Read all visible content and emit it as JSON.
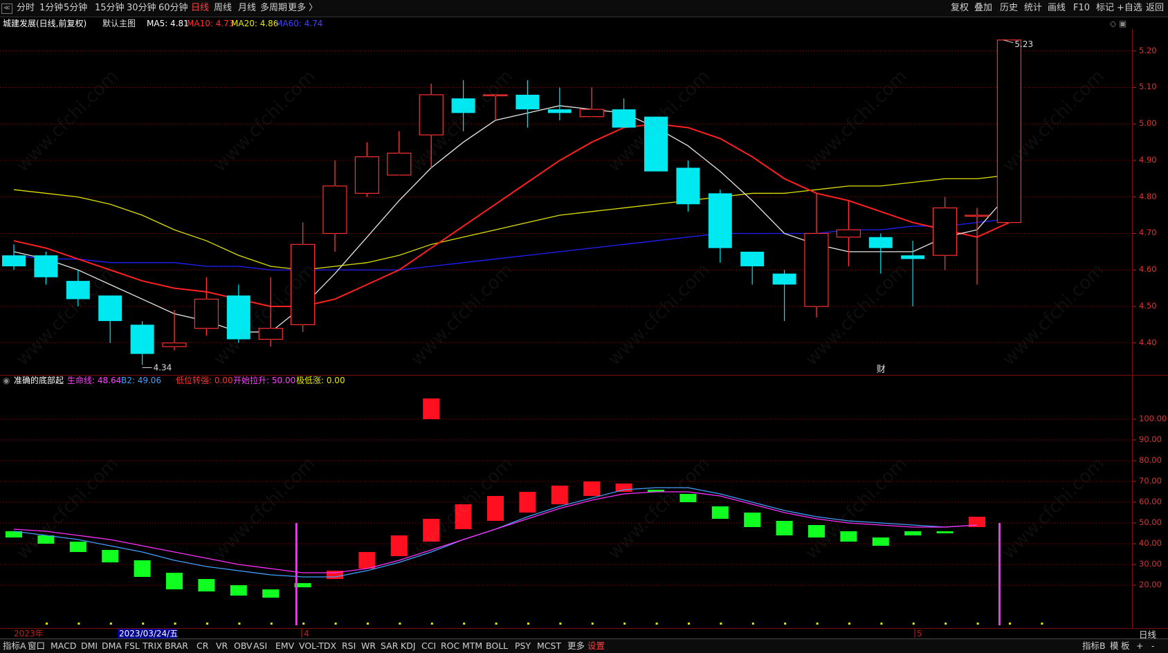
{
  "toolbar": {
    "periods": [
      "分时",
      "1分钟",
      "5分钟",
      "15分钟",
      "30分钟",
      "60分钟",
      "日线",
      "周线",
      "月线",
      "多周期",
      "更多 〉"
    ],
    "active_period": "日线",
    "right_buttons": [
      "复权",
      "叠加",
      "历史",
      "统计",
      "画线",
      "F10",
      "标记",
      "+自选",
      "返回"
    ],
    "back_glyph": "≪"
  },
  "main_info": {
    "title": "城建发展(日线,前复权)",
    "chart_name": "默认主图",
    "ma5": "MA5: 4.81",
    "ma10": "MA10: 4.73",
    "ma20": "MA20: 4.86",
    "ma60": "MA60: 4.74"
  },
  "indicator_info": {
    "name": "准确的底部起",
    "line1": "生命线: 48.64",
    "line2": "B2: 49.06",
    "v1": "低位转强: 0.00",
    "v2": "开始拉升: 50.00",
    "v3": "极低涨: 0.00"
  },
  "colors": {
    "up": "#ff3030",
    "down": "#00e8f0",
    "ma5": "#e8e8e8",
    "ma10": "#ff2020",
    "ma20": "#e0e000",
    "ma60": "#2020ff",
    "ind_up": "#ff1020",
    "ind_down": "#10ff20",
    "life_line": "#ff30ff",
    "b2_line": "#40a0ff",
    "grid": "#7a1010"
  },
  "chart_data": [
    {
      "type": "candlestick",
      "title": "城建发展(日线,前复权)",
      "y_ticks": [
        "5.20",
        "5.10",
        "5.00",
        "4.90",
        "4.80",
        "4.70",
        "4.60",
        "4.50",
        "4.40"
      ],
      "ylim": [
        4.32,
        5.26
      ],
      "candles": [
        {
          "o": 4.64,
          "h": 4.67,
          "l": 4.6,
          "c": 4.61
        },
        {
          "o": 4.64,
          "h": 4.65,
          "l": 4.56,
          "c": 4.58
        },
        {
          "o": 4.57,
          "h": 4.6,
          "l": 4.5,
          "c": 4.52
        },
        {
          "o": 4.53,
          "h": 4.53,
          "l": 4.4,
          "c": 4.46
        },
        {
          "o": 4.45,
          "h": 4.46,
          "l": 4.34,
          "c": 4.37
        },
        {
          "o": 4.39,
          "h": 4.49,
          "l": 4.38,
          "c": 4.4
        },
        {
          "o": 4.44,
          "h": 4.58,
          "l": 4.42,
          "c": 4.52
        },
        {
          "o": 4.53,
          "h": 4.56,
          "l": 4.4,
          "c": 4.41
        },
        {
          "o": 4.41,
          "h": 4.58,
          "l": 4.39,
          "c": 4.44
        },
        {
          "o": 4.45,
          "h": 4.73,
          "l": 4.43,
          "c": 4.67
        },
        {
          "o": 4.7,
          "h": 4.9,
          "l": 4.65,
          "c": 4.83
        },
        {
          "o": 4.81,
          "h": 4.95,
          "l": 4.8,
          "c": 4.91
        },
        {
          "o": 4.86,
          "h": 4.98,
          "l": 4.86,
          "c": 4.92
        },
        {
          "o": 4.97,
          "h": 5.11,
          "l": 4.88,
          "c": 5.08
        },
        {
          "o": 5.07,
          "h": 5.12,
          "l": 4.98,
          "c": 5.03
        },
        {
          "o": 5.08,
          "h": 5.08,
          "l": 5.01,
          "c": 5.08
        },
        {
          "o": 5.08,
          "h": 5.12,
          "l": 4.99,
          "c": 5.04
        },
        {
          "o": 5.04,
          "h": 5.1,
          "l": 5.01,
          "c": 5.03
        },
        {
          "o": 5.02,
          "h": 5.1,
          "l": 5.02,
          "c": 5.04
        },
        {
          "o": 5.04,
          "h": 5.07,
          "l": 4.99,
          "c": 4.99
        },
        {
          "o": 5.02,
          "h": 5.02,
          "l": 4.87,
          "c": 4.87
        },
        {
          "o": 4.88,
          "h": 4.9,
          "l": 4.76,
          "c": 4.78
        },
        {
          "o": 4.81,
          "h": 4.82,
          "l": 4.62,
          "c": 4.66
        },
        {
          "o": 4.65,
          "h": 4.65,
          "l": 4.56,
          "c": 4.61
        },
        {
          "o": 4.59,
          "h": 4.6,
          "l": 4.46,
          "c": 4.56
        },
        {
          "o": 4.5,
          "h": 4.81,
          "l": 4.47,
          "c": 4.7
        },
        {
          "o": 4.69,
          "h": 4.79,
          "l": 4.61,
          "c": 4.71
        },
        {
          "o": 4.69,
          "h": 4.7,
          "l": 4.59,
          "c": 4.66
        },
        {
          "o": 4.64,
          "h": 4.68,
          "l": 4.5,
          "c": 4.63
        },
        {
          "o": 4.64,
          "h": 4.8,
          "l": 4.6,
          "c": 4.77
        },
        {
          "o": 4.75,
          "h": 4.77,
          "l": 4.56,
          "c": 4.75
        },
        {
          "o": 4.73,
          "h": 5.23,
          "l": 4.73,
          "c": 5.23
        }
      ],
      "ma5": [
        4.65,
        4.63,
        4.6,
        4.56,
        4.52,
        4.48,
        4.46,
        4.43,
        4.43,
        4.5,
        4.59,
        4.69,
        4.79,
        4.88,
        4.95,
        5.01,
        5.03,
        5.05,
        5.04,
        5.03,
        4.99,
        4.94,
        4.87,
        4.79,
        4.7,
        4.67,
        4.65,
        4.65,
        4.65,
        4.69,
        4.71,
        4.81
      ],
      "ma10": [
        4.68,
        4.66,
        4.63,
        4.6,
        4.57,
        4.55,
        4.54,
        4.52,
        4.5,
        4.5,
        4.52,
        4.56,
        4.6,
        4.66,
        4.72,
        4.78,
        4.84,
        4.9,
        4.95,
        4.99,
        5.0,
        4.99,
        4.96,
        4.91,
        4.85,
        4.81,
        4.79,
        4.76,
        4.73,
        4.71,
        4.69,
        4.73
      ],
      "ma20": [
        4.82,
        4.81,
        4.8,
        4.78,
        4.75,
        4.71,
        4.68,
        4.64,
        4.61,
        4.6,
        4.61,
        4.62,
        4.64,
        4.67,
        4.69,
        4.71,
        4.73,
        4.75,
        4.76,
        4.77,
        4.78,
        4.79,
        4.8,
        4.81,
        4.81,
        4.82,
        4.83,
        4.83,
        4.84,
        4.85,
        4.85,
        4.86
      ],
      "ma60": [
        4.64,
        4.63,
        4.63,
        4.62,
        4.62,
        4.62,
        4.61,
        4.61,
        4.6,
        4.6,
        4.6,
        4.6,
        4.6,
        4.61,
        4.62,
        4.63,
        4.64,
        4.65,
        4.66,
        4.67,
        4.68,
        4.69,
        4.7,
        4.7,
        4.7,
        4.7,
        4.71,
        4.71,
        4.72,
        4.72,
        4.73,
        4.74
      ],
      "low_label": "4.34",
      "high_label": "5.23",
      "marker_text": "财"
    },
    {
      "type": "bar",
      "title": "准确的底部起",
      "y_ticks": [
        "100.00",
        "90.00",
        "80.00",
        "70.00",
        "60.00",
        "50.00",
        "40.00",
        "30.00",
        "20.00"
      ],
      "ylim": [
        0,
        120
      ],
      "bars": [
        {
          "a": 43,
          "b": 46,
          "up": false
        },
        {
          "a": 40,
          "b": 44,
          "up": false
        },
        {
          "a": 36,
          "b": 41,
          "up": false
        },
        {
          "a": 31,
          "b": 37,
          "up": false
        },
        {
          "a": 24,
          "b": 32,
          "up": false
        },
        {
          "a": 18,
          "b": 26,
          "up": false
        },
        {
          "a": 17,
          "b": 23,
          "up": false
        },
        {
          "a": 15,
          "b": 20,
          "up": false
        },
        {
          "a": 14,
          "b": 18,
          "up": false
        },
        {
          "a": 19,
          "b": 21,
          "up": false
        },
        {
          "a": 23,
          "b": 27,
          "up": true
        },
        {
          "a": 28,
          "b": 36,
          "up": true
        },
        {
          "a": 34,
          "b": 44,
          "up": true
        },
        {
          "a": 41,
          "b": 52,
          "up": true
        },
        {
          "a": 47,
          "b": 59,
          "up": true
        },
        {
          "a": 51,
          "b": 63,
          "up": true
        },
        {
          "a": 55,
          "b": 65,
          "up": true
        },
        {
          "a": 59,
          "b": 68,
          "up": true
        },
        {
          "a": 63,
          "b": 70,
          "up": true
        },
        {
          "a": 65,
          "b": 69,
          "up": true
        },
        {
          "a": 65,
          "b": 66,
          "up": false
        },
        {
          "a": 60,
          "b": 64,
          "up": false
        },
        {
          "a": 52,
          "b": 58,
          "up": false
        },
        {
          "a": 48,
          "b": 55,
          "up": false
        },
        {
          "a": 44,
          "b": 51,
          "up": false
        },
        {
          "a": 43,
          "b": 49,
          "up": false
        },
        {
          "a": 41,
          "b": 46,
          "up": false
        },
        {
          "a": 39,
          "b": 43,
          "up": false
        },
        {
          "a": 44,
          "b": 46,
          "up": false
        },
        {
          "a": 45,
          "b": 46,
          "up": false
        },
        {
          "a": 48,
          "b": 53,
          "up": true
        }
      ],
      "top_bar": {
        "i": 13,
        "a": 100,
        "b": 110
      },
      "life_line": [
        47,
        46,
        44,
        42,
        39,
        36,
        33,
        30,
        28,
        26,
        26,
        28,
        32,
        37,
        42,
        47,
        52,
        57,
        61,
        64,
        65,
        65,
        63,
        59,
        55,
        52,
        50,
        49,
        48,
        48,
        49
      ],
      "b2_line": [
        46,
        44,
        42,
        39,
        36,
        32,
        29,
        27,
        25,
        24,
        24,
        27,
        31,
        36,
        42,
        47,
        53,
        58,
        62,
        66,
        67,
        67,
        64,
        60,
        56,
        53,
        51,
        50,
        49,
        48,
        49
      ],
      "signal_bars": [
        {
          "i": 9,
          "value": 50
        },
        {
          "i": 31,
          "value": 50
        }
      ]
    }
  ],
  "x_axis": {
    "year_label": "2023年",
    "date_label": "2023/03/24/五",
    "month_marks": [
      {
        "i": 9,
        "label": "4"
      },
      {
        "i": 28,
        "label": "5"
      }
    ]
  },
  "right_bottom_label": "日线",
  "bottom_tabs": [
    "指标A",
    "窗口",
    "MACD",
    "DMI",
    "DMA",
    "FSL",
    "TRIX",
    "BRAR",
    "CR",
    "VR",
    "OBV",
    "ASI",
    "EMV",
    "VOL-TDX",
    "RSI",
    "WR",
    "SAR",
    "KDJ",
    "CCI",
    "ROC",
    "MTM",
    "BOLL",
    "PSY",
    "MCST",
    "更多",
    "设置"
  ],
  "bottom_right": [
    "指标B",
    "模",
    "板",
    "+",
    "-"
  ],
  "watermark": "www.cfchi.com"
}
